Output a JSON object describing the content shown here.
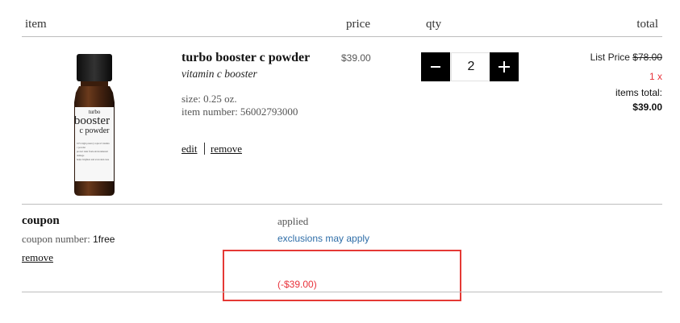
{
  "header": {
    "item": "item",
    "price": "price",
    "qty": "qty",
    "total": "total"
  },
  "product": {
    "name": "turbo booster c powder",
    "subtitle": "vitamin c booster",
    "size": "size: 0.25 oz.",
    "item_number": "item number: 56002793000",
    "price": "$39.00",
    "quantity": "2",
    "qty_minus": "–",
    "qty_plus": "+",
    "edit_label": "edit",
    "remove_label": "remove",
    "list_price_label": "List Price",
    "list_price_value": "$78.00",
    "quantity_times": "1 x",
    "items_total_label": "items total:",
    "items_total_value": "$39.00",
    "image_label": {
      "line1": "turbo",
      "line2": "booster",
      "line3": "c powder",
      "small_text": [
        "10% high potency topical vitamin",
        "c powder",
        "protect skin from environmental",
        "damage",
        "helps brighten and even skin tone"
      ]
    }
  },
  "coupon": {
    "title": "coupon",
    "number_label": "coupon number:",
    "number_value": "1free",
    "remove_label": "remove",
    "status": "applied",
    "exclusions": "exclusions may apply",
    "discount": "(-$39.00)"
  },
  "colors": {
    "accent_red": "#e8313a",
    "link_blue": "#2f6ea8",
    "highlight_box": "#e53935"
  }
}
